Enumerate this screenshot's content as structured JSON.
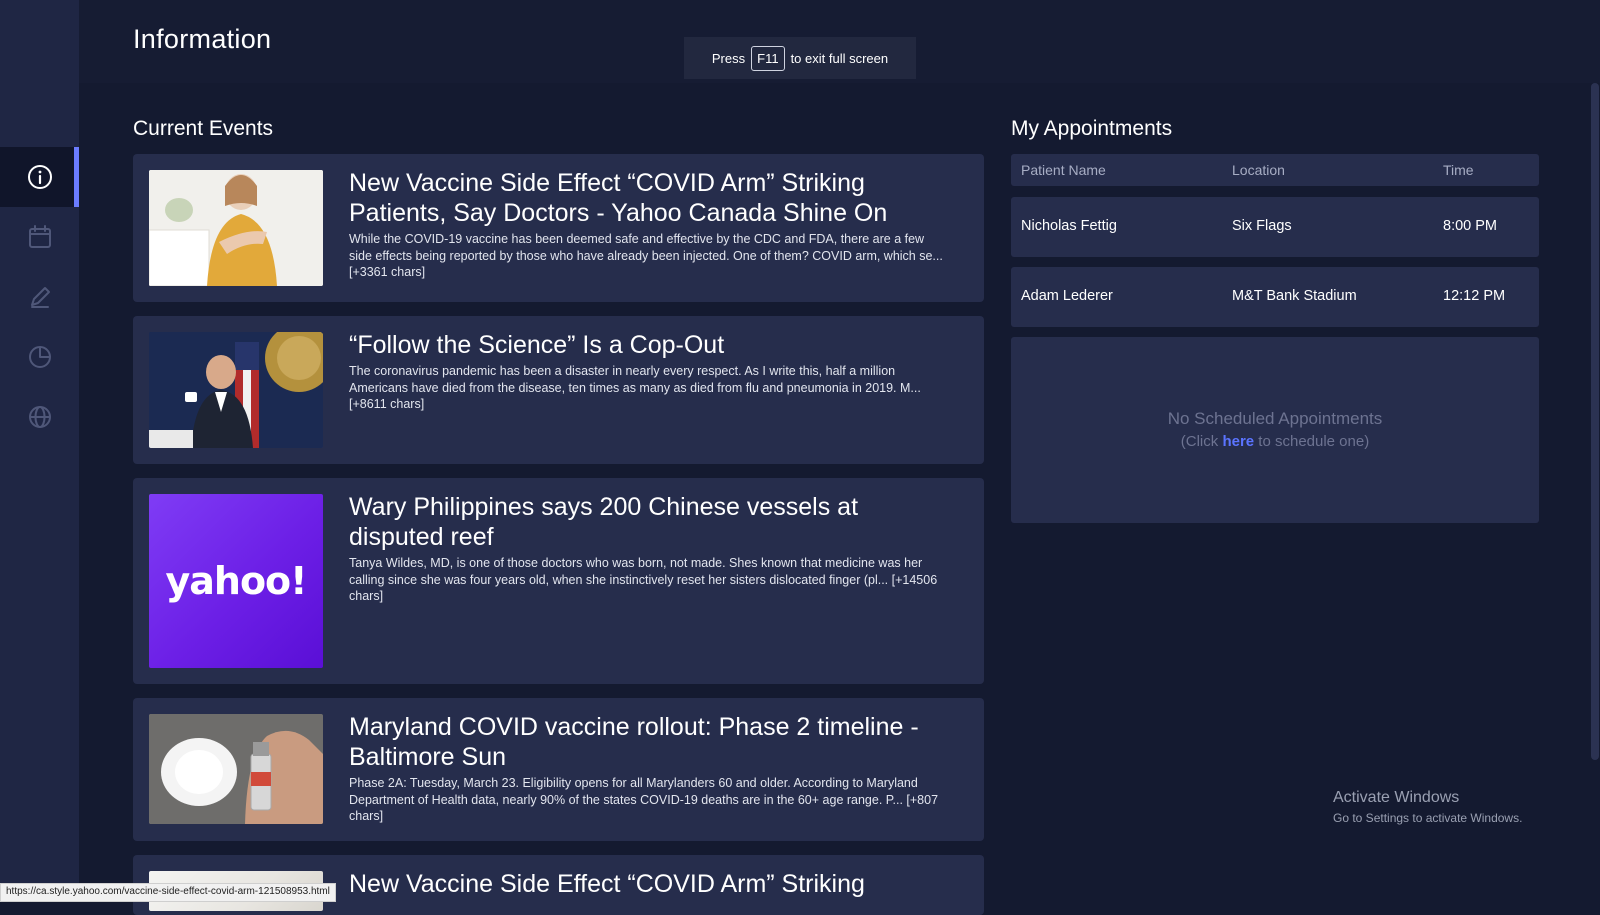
{
  "header": {
    "title": "Information",
    "fullscreen_notice": {
      "press": "Press",
      "key": "F11",
      "rest": "to exit full screen"
    }
  },
  "sidebar": {
    "items": [
      {
        "icon": "info-icon",
        "active": true
      },
      {
        "icon": "calendar-icon",
        "active": false
      },
      {
        "icon": "pencil-icon",
        "active": false
      },
      {
        "icon": "pie-chart-icon",
        "active": false
      },
      {
        "icon": "globe-icon",
        "active": false
      }
    ]
  },
  "current_events": {
    "title": "Current Events",
    "articles": [
      {
        "headline": "New Vaccine Side Effect “COVID Arm” Striking Patients, Say Doctors - Yahoo Canada Shine On",
        "description": "While the COVID-19 vaccine has been deemed safe and effective by the CDC and FDA, there are a few side effects being reported by those who have already been injected. One of them? COVID arm, which se... [+3361 chars]"
      },
      {
        "headline": "“Follow the Science” Is a Cop-Out",
        "description": "The coronavirus pandemic has been a disaster in nearly every respect. As I write this, half a million Americans have died from the disease, ten times as many as died from flu and pneumonia in 2019. M... [+8611 chars]"
      },
      {
        "headline": "Wary Philippines says 200 Chinese vessels at disputed reef",
        "description": "Tanya Wildes, MD, is one of those doctors who was born, not made. Shes known that medicine was her calling since she was four years old, when she instinctively reset her sisters dislocated finger (pl... [+14506 chars]",
        "thumb_logo": "yahoo!"
      },
      {
        "headline": "Maryland COVID vaccine rollout: Phase 2 timeline - Baltimore Sun",
        "description": "Phase 2A: Tuesday, March 23. Eligibility opens for all Marylanders 60 and older. According to Maryland Department of Health data, nearly 90% of the states COVID-19 deaths are in the 60+ age range. P... [+807 chars]"
      },
      {
        "headline": "New Vaccine Side Effect “COVID Arm” Striking",
        "description": ""
      }
    ]
  },
  "appointments": {
    "title": "My Appointments",
    "columns": [
      "Patient Name",
      "Location",
      "Time"
    ],
    "rows": [
      {
        "name": "Nicholas Fettig",
        "location": "Six Flags",
        "time": "8:00 PM"
      },
      {
        "name": "Adam Lederer",
        "location": "M&T Bank Stadium",
        "time": "12:12 PM"
      }
    ],
    "empty": {
      "main": "No Scheduled Appointments",
      "sub_pre": "(Click",
      "link": "here",
      "sub_post": "to schedule one)"
    }
  },
  "activate_windows": {
    "title": "Activate Windows",
    "subtitle": "Go to Settings to activate Windows."
  },
  "status_bar": {
    "url": "https://ca.style.yahoo.com/vaccine-side-effect-covid-arm-121508953.html"
  },
  "colors": {
    "background": "#141a30",
    "sidebar": "#1f2644",
    "card": "#262d4c",
    "accent": "#6b7cff",
    "link": "#5b74ff"
  }
}
